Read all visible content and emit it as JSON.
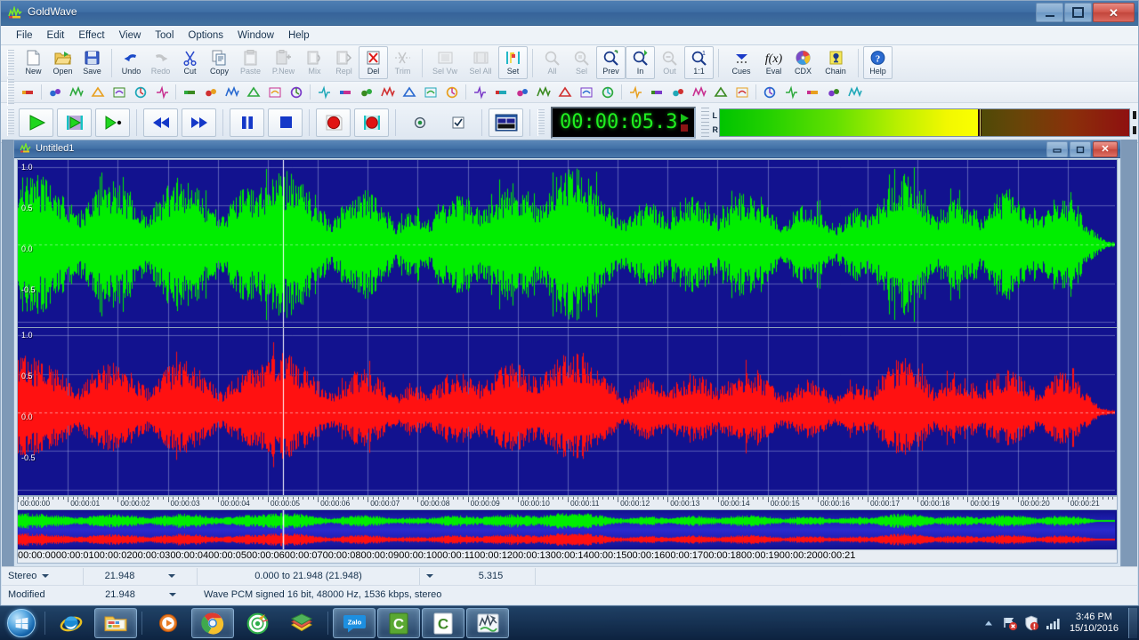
{
  "window": {
    "title": "GoldWave",
    "icon": "goldwave-icon",
    "minimize_label": "–",
    "maximize_label": "□",
    "close_label": "✕"
  },
  "menu": {
    "items": [
      "File",
      "Edit",
      "Effect",
      "View",
      "Tool",
      "Options",
      "Window",
      "Help"
    ]
  },
  "toolbar": {
    "groups": [
      {
        "name": "file",
        "buttons": [
          {
            "label": "New",
            "icon": "new-file-icon",
            "enabled": true
          },
          {
            "label": "Open",
            "icon": "open-folder-icon",
            "enabled": true
          },
          {
            "label": "Save",
            "icon": "floppy-disk-icon",
            "enabled": true
          }
        ]
      },
      {
        "name": "edit",
        "buttons": [
          {
            "label": "Undo",
            "icon": "undo-arrow-icon",
            "enabled": true
          },
          {
            "label": "Redo",
            "icon": "redo-arrow-icon",
            "enabled": false
          },
          {
            "label": "Cut",
            "icon": "scissors-icon",
            "enabled": true
          },
          {
            "label": "Copy",
            "icon": "copy-pages-icon",
            "enabled": true
          },
          {
            "label": "Paste",
            "icon": "clipboard-icon",
            "enabled": false
          },
          {
            "label": "P.New",
            "icon": "paste-new-icon",
            "enabled": false
          },
          {
            "label": "Mix",
            "icon": "mix-icon",
            "enabled": false
          },
          {
            "label": "Repl",
            "icon": "replace-icon",
            "enabled": false
          },
          {
            "label": "Del",
            "icon": "delete-x-icon",
            "enabled": true
          },
          {
            "label": "Trim",
            "icon": "trim-icon",
            "enabled": false
          }
        ]
      },
      {
        "name": "select",
        "buttons": [
          {
            "label": "Sel Vw",
            "icon": "select-view-icon",
            "enabled": false
          },
          {
            "label": "Sel All",
            "icon": "select-all-icon",
            "enabled": false
          },
          {
            "label": "Set",
            "icon": "set-markers-icon",
            "enabled": true
          }
        ]
      },
      {
        "name": "zoom",
        "buttons": [
          {
            "label": "All",
            "icon": "zoom-all-icon",
            "enabled": false
          },
          {
            "label": "Sel",
            "icon": "zoom-sel-icon",
            "enabled": false
          },
          {
            "label": "Prev",
            "icon": "zoom-prev-icon",
            "enabled": true
          },
          {
            "label": "In",
            "icon": "zoom-in-icon",
            "enabled": true
          },
          {
            "label": "Out",
            "icon": "zoom-out-icon",
            "enabled": false
          },
          {
            "label": "1:1",
            "icon": "zoom-1to1-icon",
            "enabled": true
          }
        ]
      },
      {
        "name": "tools",
        "buttons": [
          {
            "label": "Cues",
            "icon": "cues-icon",
            "enabled": true
          },
          {
            "label": "Eval",
            "icon": "eval-fx-icon",
            "enabled": true
          },
          {
            "label": "CDX",
            "icon": "cdx-disc-icon",
            "enabled": true
          },
          {
            "label": "Chain",
            "icon": "chain-icon",
            "enabled": true
          }
        ]
      },
      {
        "name": "help",
        "buttons": [
          {
            "label": "Help",
            "icon": "help-question-icon",
            "enabled": true
          }
        ]
      }
    ]
  },
  "effects_toolbar": {
    "icons": [
      "bass-boost-icon",
      "auto-gain-icon",
      "channel-mixer-icon",
      "compressor-icon",
      "dynamics-icon",
      "doppler-icon",
      "echo-icon",
      "filter-icon",
      "flanger-icon",
      "graphic-eq-icon",
      "parametric-eq-icon",
      "interpolate-icon",
      "invert-icon",
      "mechanize-icon",
      "noise-reduction-icon",
      "offset-icon",
      "pan-icon",
      "pitch-icon",
      "playback-rate-icon",
      "reverb-icon",
      "resample-icon",
      "reverse-icon",
      "silence-icon",
      "smoother-icon",
      "stereo-icon",
      "time-warp-icon",
      "volume-shape-icon",
      "volume-icon",
      "fade-in-icon",
      "fade-out-icon",
      "match-volume-icon",
      "maximize-volume-icon",
      "frequency-icon",
      "frequency-split-icon",
      "swap-channels-icon",
      "change-volume-icon",
      "spectrum-icon",
      "envelope-icon"
    ]
  },
  "transport": {
    "buttons": [
      {
        "name": "play-button",
        "icon": "play-icon"
      },
      {
        "name": "play-selection-button",
        "icon": "play-selection-icon"
      },
      {
        "name": "play-from-marker-button",
        "icon": "play-marker-icon"
      },
      {
        "name": "rewind-button",
        "icon": "rewind-icon"
      },
      {
        "name": "fast-forward-button",
        "icon": "fast-forward-icon"
      },
      {
        "name": "pause-button",
        "icon": "pause-icon"
      },
      {
        "name": "stop-button",
        "icon": "stop-icon"
      },
      {
        "name": "record-button",
        "icon": "record-icon"
      },
      {
        "name": "record-new-button",
        "icon": "record-new-icon"
      }
    ],
    "option_toggle_icon": "record-option-icon",
    "option_check_icon": "checkbox-icon",
    "window_view_icon": "window-layout-icon",
    "time_display": "00:00:05.3",
    "play_indicator_icon": "play-triangle-indicator",
    "record_indicator_icon": "record-square-indicator",
    "meter": {
      "channel_left": "L",
      "channel_right": "R",
      "level_percent": 63,
      "color_low": "#00c400",
      "color_mid": "#9ae600",
      "color_high": "#fbff00",
      "color_unlit": "#8f1010"
    }
  },
  "document": {
    "title": "Untitled1",
    "icon": "goldwave-doc-icon",
    "minimize_label": "–",
    "maximize_label": "□",
    "close_label": "✕",
    "amplitude_labels": [
      "1.0",
      "0.5",
      "0.0",
      "-0.5"
    ],
    "left_channel_color": "#00ee00",
    "right_channel_color": "#ff1111",
    "background_color": "#12128f",
    "ruler_labels": [
      "00:00:00",
      "00:00:01",
      "00:00:02",
      "00:00:03",
      "00:00:04",
      "00:00:05",
      "00:00:06",
      "00:00:07",
      "00:00:08",
      "00:00:09",
      "00:00:10",
      "00:00:11",
      "00:00:12",
      "00:00:13",
      "00:00:14",
      "00:00:15",
      "00:00:16",
      "00:00:17",
      "00:00:18",
      "00:00:19",
      "00:00:20",
      "00:00:21"
    ],
    "playhead_time_seconds": 5.3,
    "total_seconds": 21.948
  },
  "status": {
    "row1": {
      "channels": "Stereo",
      "length": "21.948",
      "selection": "0.000 to 21.948 (21.948)",
      "position": "5.315"
    },
    "row2": {
      "state": "Modified",
      "length": "21.948",
      "format": "Wave PCM signed 16 bit, 48000 Hz, 1536 kbps, stereo"
    }
  },
  "taskbar": {
    "start_icon": "windows-start-orb",
    "items": [
      {
        "name": "taskbar-internet-explorer",
        "icon": "internet-explorer-icon",
        "active": false
      },
      {
        "name": "taskbar-windows-explorer",
        "icon": "folder-explorer-icon",
        "active": true
      },
      {
        "name": "taskbar-media-player",
        "icon": "media-player-icon",
        "active": false
      },
      {
        "name": "taskbar-chrome",
        "icon": "chrome-icon",
        "active": true
      },
      {
        "name": "taskbar-disc-burner",
        "icon": "disc-burner-icon",
        "active": false
      },
      {
        "name": "taskbar-book-app",
        "icon": "book-stack-icon",
        "active": false
      },
      {
        "name": "taskbar-zalo",
        "icon": "zalo-icon",
        "active": true,
        "label": "Zalo"
      },
      {
        "name": "taskbar-app-c1",
        "icon": "green-c-icon",
        "active": true,
        "label": "C"
      },
      {
        "name": "taskbar-app-c2",
        "icon": "white-c-icon",
        "active": true,
        "label": "C"
      },
      {
        "name": "taskbar-goldwave",
        "icon": "goldwave-taskbar-icon",
        "active": true
      }
    ],
    "tray": {
      "show_hidden_icon": "chevron-up-icon",
      "icons": [
        "network-error-icon",
        "security-alert-icon",
        "volume-bars-icon"
      ],
      "time": "3:46 PM",
      "date": "15/10/2016"
    }
  }
}
